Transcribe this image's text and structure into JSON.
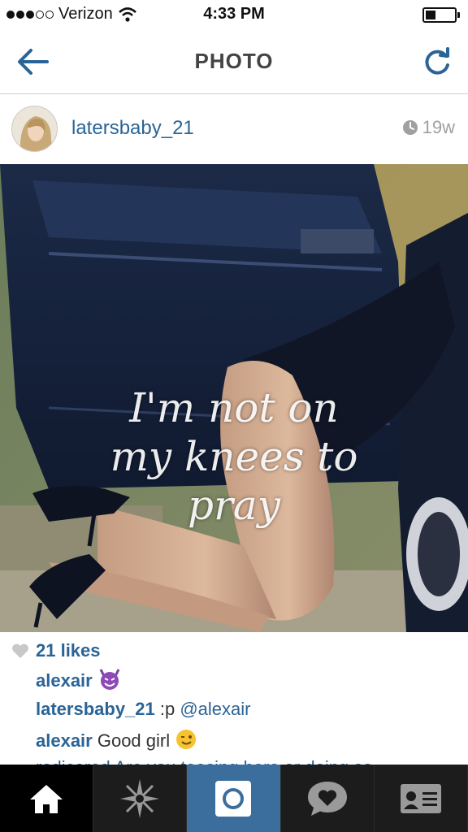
{
  "status_bar": {
    "carrier": "Verizon",
    "time": "4:33 PM",
    "signal_bars_filled": 3,
    "signal_bars_total": 5,
    "battery_level": 0.35
  },
  "nav": {
    "title": "PHOTO",
    "back_icon": "arrow-left-icon",
    "refresh_icon": "refresh-icon"
  },
  "post": {
    "username": "latersbaby_21",
    "age": "19w",
    "photo_caption_lines": [
      "I'm not on",
      "my knees to",
      "pray"
    ],
    "likes": "21 likes"
  },
  "comments": [
    {
      "user": "alexair",
      "text": ""
    },
    {
      "user": "latersbaby_21",
      "text": " :p ",
      "mention": "@alexair"
    },
    {
      "user": "alexair",
      "text": " Good girl "
    },
    {
      "user": "",
      "text": "rodicerad Are you teasing here or doing so"
    }
  ],
  "tabs": [
    {
      "name": "home",
      "icon": "home-icon"
    },
    {
      "name": "explore",
      "icon": "star-compass-icon"
    },
    {
      "name": "camera",
      "icon": "camera-icon"
    },
    {
      "name": "activity",
      "icon": "heart-bubble-icon"
    },
    {
      "name": "profile",
      "icon": "profile-card-icon"
    }
  ],
  "colors": {
    "link": "#2a6496",
    "tab_bar": "#1c1c1c",
    "camera_tab": "#3b6e9c",
    "nav_icon": "#2a6496"
  }
}
